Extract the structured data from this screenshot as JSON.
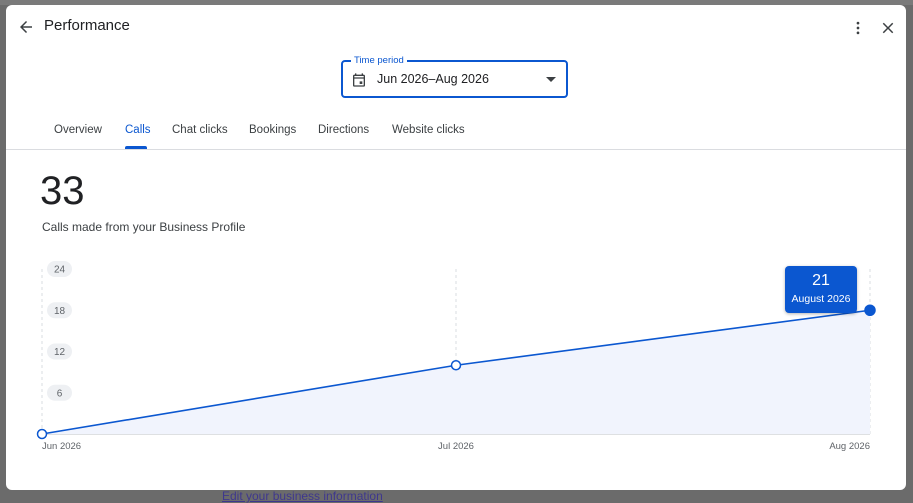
{
  "header": {
    "title": "Performance",
    "back_icon": "arrow-back-icon",
    "more_icon": "more-vert-icon",
    "close_icon": "close-icon"
  },
  "time_period": {
    "label": "Time period",
    "value": "Jun 2026–Aug 2026",
    "icon": "calendar-icon"
  },
  "tabs": [
    {
      "label": "Overview",
      "active": false
    },
    {
      "label": "Calls",
      "active": true
    },
    {
      "label": "Chat clicks",
      "active": false
    },
    {
      "label": "Bookings",
      "active": false
    },
    {
      "label": "Directions",
      "active": false
    },
    {
      "label": "Website clicks",
      "active": false
    }
  ],
  "metric": {
    "value": "33",
    "description": "Calls made from your Business Profile"
  },
  "tooltip": {
    "value": "21",
    "date": "August 2026"
  },
  "background": {
    "link_text": "Edit your business information"
  },
  "colors": {
    "accent": "#0b57d0",
    "area_fill": "#f1f4fd"
  },
  "chart_data": {
    "type": "line",
    "x": [
      "Jun 2026",
      "Jul 2026",
      "Aug 2026"
    ],
    "series": [
      {
        "values": [
          0,
          10,
          18
        ]
      }
    ],
    "y_ticks": [
      "24",
      "18",
      "12",
      "6"
    ],
    "ylim": [
      0,
      24
    ],
    "grid": "vertical-dashed",
    "highlight_index": 2
  }
}
